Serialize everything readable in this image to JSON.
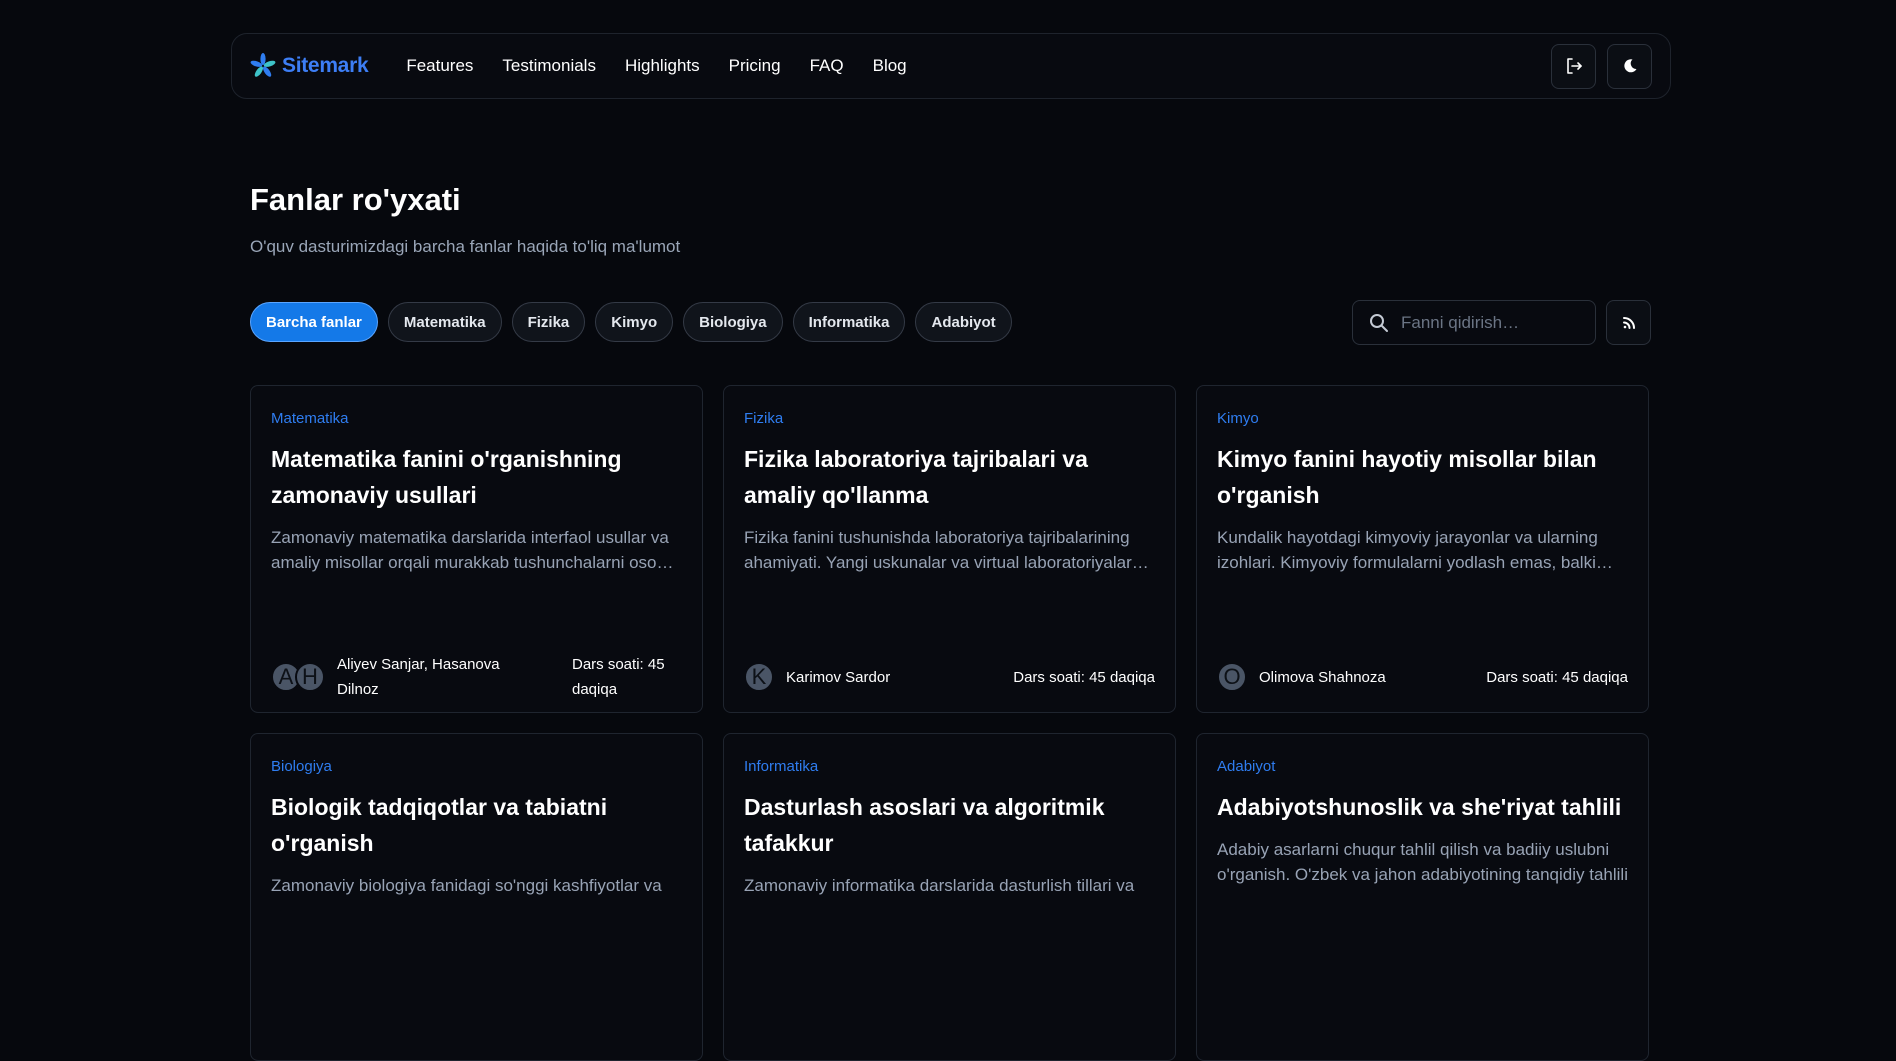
{
  "nav": {
    "brand": "Sitemark",
    "links": [
      "Features",
      "Testimonials",
      "Highlights",
      "Pricing",
      "FAQ",
      "Blog"
    ],
    "actions": [
      "logout-icon",
      "moon-icon"
    ]
  },
  "header": {
    "title": "Fanlar ro'yxati",
    "subtitle": "O'quv dasturimizdagi barcha fanlar haqida to'liq ma'lumot"
  },
  "filters": {
    "chips": [
      "Barcha fanlar",
      "Matematika",
      "Fizika",
      "Kimyo",
      "Biologiya",
      "Informatika",
      "Adabiyot"
    ],
    "active": "Barcha fanlar",
    "search_placeholder": "Fanni qidirish…"
  },
  "cards": [
    {
      "category": "Matematika",
      "title": "Matematika fanini o'rganishning zamonaviy usullari",
      "desc": "Zamonaviy matematika darslarida interfaol usullar va amaliy misollar orqali murakkab tushunchalarni oson o'rganish",
      "avatars": [
        "A",
        "H"
      ],
      "author": "Aliyev Sanjar, Hasanova Dilnoz",
      "hours": "Dars soati: 45 daqiqa"
    },
    {
      "category": "Fizika",
      "title": "Fizika laboratoriya tajribalari va amaliy qo'llanma",
      "desc": "Fizika fanini tushunishda laboratoriya tajribalarining ahamiyati. Yangi uskunalar va virtual laboratoriyalar haqida",
      "avatars": [
        "K"
      ],
      "author": "Karimov Sardor",
      "hours": "Dars soati: 45 daqiqa"
    },
    {
      "category": "Kimyo",
      "title": "Kimyo fanini hayotiy misollar bilan o'rganish",
      "desc": "Kundalik hayotdagi kimyoviy jarayonlar va ularning izohlari. Kimyoviy formulalarni yodlash emas, balki tushunish",
      "avatars": [
        "O"
      ],
      "author": "Olimova Shahnoza",
      "hours": "Dars soati: 45 daqiqa"
    },
    {
      "category": "Biologiya",
      "title": "Biologik tadqiqotlar va tabiatni o'rganish",
      "desc": "Zamonaviy biologiya fanidagi so'nggi kashfiyotlar va ",
      "avatars": [],
      "author": "",
      "hours": ""
    },
    {
      "category": "Informatika",
      "title": "Dasturlash asoslari va algoritmik tafakkur",
      "desc": "Zamonaviy informatika darslarida dasturlish tillari va ",
      "avatars": [],
      "author": "",
      "hours": ""
    },
    {
      "category": "Adabiyot",
      "title": "Adabiyotshunoslik va she'riyat tahlili",
      "desc": "Adabiy asarlarni chuqur tahlil qilish va badiiy uslubni o'rganish. O'zbek va jahon adabiyotining tanqidiy tahlili",
      "avatars": [],
      "author": "",
      "hours": ""
    }
  ],
  "colors": {
    "background": "#06080d",
    "accent": "#1479e8",
    "brand": "#3d7ef5",
    "category": "#2f7df0",
    "muted_text": "#98a3b5"
  }
}
